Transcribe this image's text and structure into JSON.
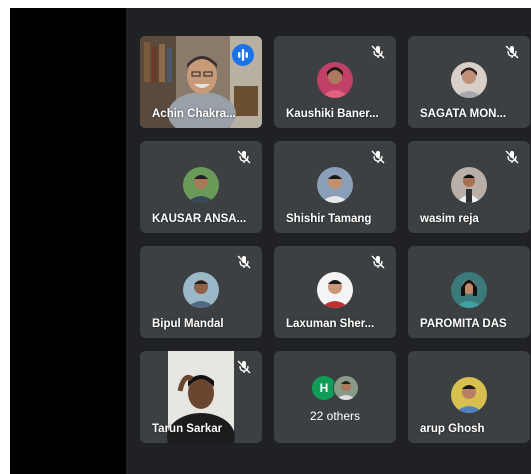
{
  "participants": [
    {
      "name": "Achin Chakra...",
      "state": "speaking"
    },
    {
      "name": "Kaushiki Baner...",
      "state": "muted"
    },
    {
      "name": "SAGATA MON...",
      "state": "muted"
    },
    {
      "name": "KAUSAR ANSA...",
      "state": "muted"
    },
    {
      "name": "Shishir Tamang",
      "state": "muted"
    },
    {
      "name": "wasim reja",
      "state": "muted"
    },
    {
      "name": "Bipul Mandal",
      "state": "muted"
    },
    {
      "name": "Laxuman Sher...",
      "state": "muted"
    },
    {
      "name": "PAROMITA DAS",
      "state": "muted"
    },
    {
      "name": "Tarun Sarkar",
      "state": "muted"
    },
    {
      "name": "arup Ghosh",
      "state": "muted"
    }
  ],
  "others": {
    "initial": "H",
    "label": "22 others"
  },
  "colors": {
    "stage": "#202124",
    "tile": "#3c4043",
    "active_border": "#8ab4f8",
    "speaking_badge": "#1a73e8",
    "others_avatar": "#0f9d58"
  },
  "icons": {
    "muted": "mic-off-icon",
    "speaking": "audio-level-icon"
  }
}
